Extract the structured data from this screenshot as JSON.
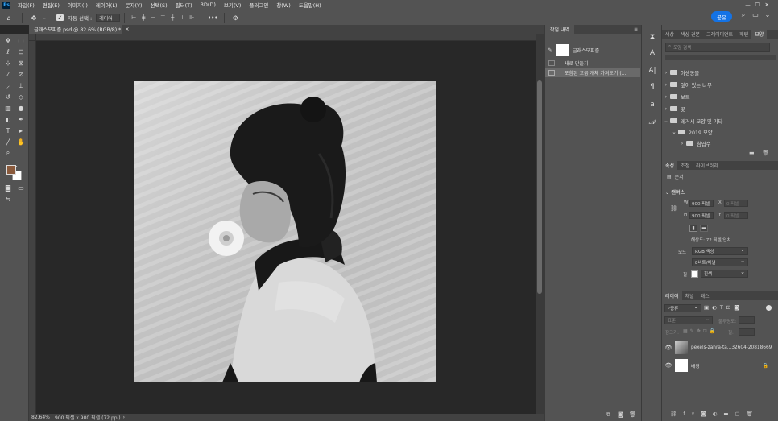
{
  "menu": {
    "logo": "Ps",
    "items": [
      "파일(F)",
      "편집(E)",
      "이미지(I)",
      "레이어(L)",
      "문자(Y)",
      "선택(S)",
      "필터(T)",
      "3D(D)",
      "보기(V)",
      "플러그인",
      "창(W)",
      "도움말(H)"
    ]
  },
  "options": {
    "auto_select_label": "자동 선택 :",
    "auto_select_value": "레이어",
    "more": "•••",
    "share_label": "공유"
  },
  "document": {
    "tab_title": "글래스모피즘.psd @ 82.6% (RGB/8) *",
    "zoom": "82.64%",
    "doc_info": "900 픽셀 x 900 픽셀 (72 ppi)"
  },
  "history_panel": {
    "tab": "작업 내역",
    "snapshot_name": "글래스모피즘",
    "items": [
      "새로 만들기",
      "포함된 고급 개체 가져오기 (..."
    ]
  },
  "shapes_panel": {
    "tabs": [
      "색상",
      "색상 견본",
      "그레이디언트",
      "패턴",
      "모양"
    ],
    "active_tab": "모양",
    "search_placeholder": "모양 검색",
    "folders": [
      "야생동물",
      "잎이 있는 나무",
      "보트",
      "꽃",
      "레거시 모양 및 기타",
      "2019 모양",
      "침엽수"
    ]
  },
  "properties_panel": {
    "tabs": [
      "속성",
      "조정",
      "라이브러리"
    ],
    "active_tab": "속성",
    "doc_label": "문서",
    "section": "캔버스",
    "w_label": "W",
    "w_value": "900 픽셀",
    "h_label": "H",
    "h_value": "900 픽셀",
    "x_label": "X",
    "x_value": "0 픽셀",
    "y_label": "Y",
    "y_value": "0 픽셀",
    "resolution": "해상도: 72 픽셀/인치",
    "mode_label": "모드",
    "mode_value": "RGB 색상",
    "depth_value": "8비트/채널",
    "fill_label": "칠",
    "fill_value": "흰색"
  },
  "layers_panel": {
    "tabs": [
      "레이어",
      "채널",
      "패스"
    ],
    "active_tab": "레이어",
    "filter_value": "종류",
    "blend_mode": "표준",
    "opacity_label": "불투명도:",
    "lock_label": "잠그기:",
    "fill_label": "칠:",
    "layers": [
      {
        "name": "pexels-zahra-ta...32604-20818669",
        "locked": false
      },
      {
        "name": "배경",
        "locked": true
      }
    ]
  },
  "colors": {
    "foreground": "#8a5a3c",
    "background": "#ffffff",
    "share": "#1473e6"
  }
}
